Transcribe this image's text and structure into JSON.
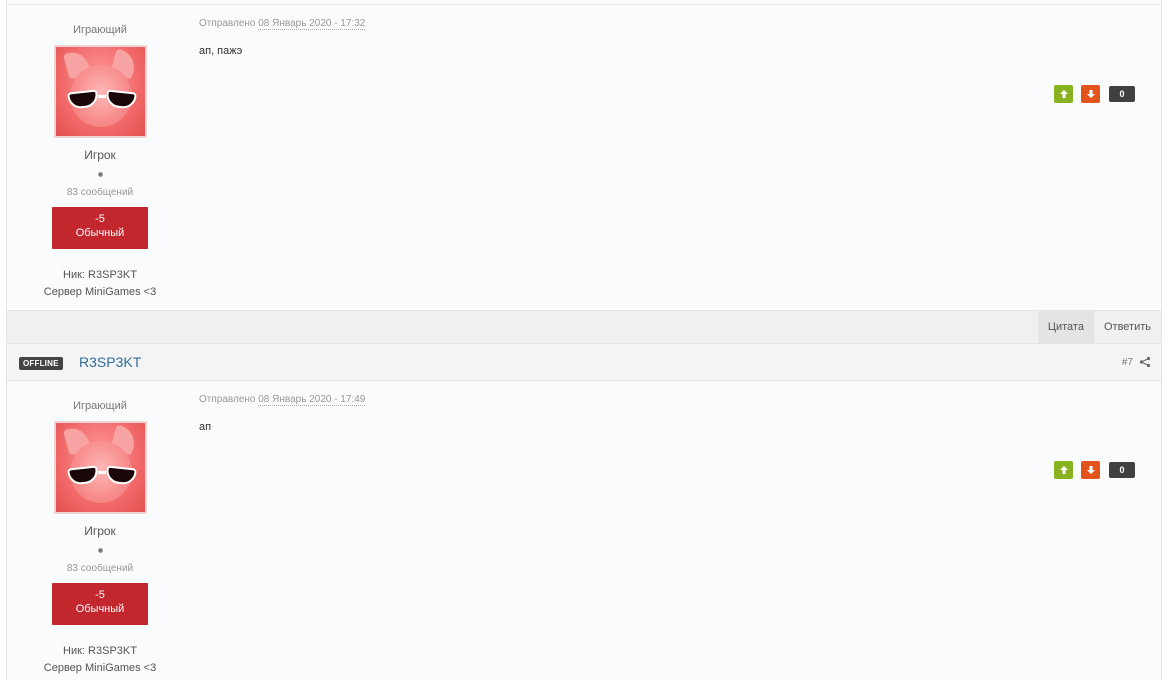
{
  "posts": [
    {
      "group": "Играющий",
      "rank": "Игрок",
      "post_count": "83 сообщений",
      "rep_value": "-5",
      "rep_label": "Обычный",
      "nick_field": "Ник: R3SP3KT",
      "server_field": "Сервер MiniGames <3",
      "posted_prefix": "Отправлено",
      "posted_date": "08 Январь 2020 - 17:32",
      "text": "ап, пажэ",
      "vote_count": "0"
    },
    {
      "group": "Играющий",
      "rank": "Игрок",
      "post_count": "83 сообщений",
      "rep_value": "-5",
      "rep_label": "Обычный",
      "nick_field": "Ник: R3SP3KT",
      "server_field": "Сервер MiniGames <3",
      "posted_prefix": "Отправлено",
      "posted_date": "08 Январь 2020 - 17:49",
      "text": "ап",
      "vote_count": "0"
    }
  ],
  "controls": {
    "quote_label": "Цитата",
    "reply_label": "Ответить"
  },
  "header": {
    "status_badge": "OFFLINE",
    "author_name": "R3SP3KT",
    "post_number": "#7"
  },
  "colors": {
    "rep_negative": "#c1272d",
    "vote_up": "#88b320",
    "vote_down": "#e2541c",
    "author_link": "#2f6d9e"
  },
  "icons": {
    "vote_up": "arrow-up-icon",
    "vote_down": "arrow-down-icon",
    "share": "share-icon"
  }
}
